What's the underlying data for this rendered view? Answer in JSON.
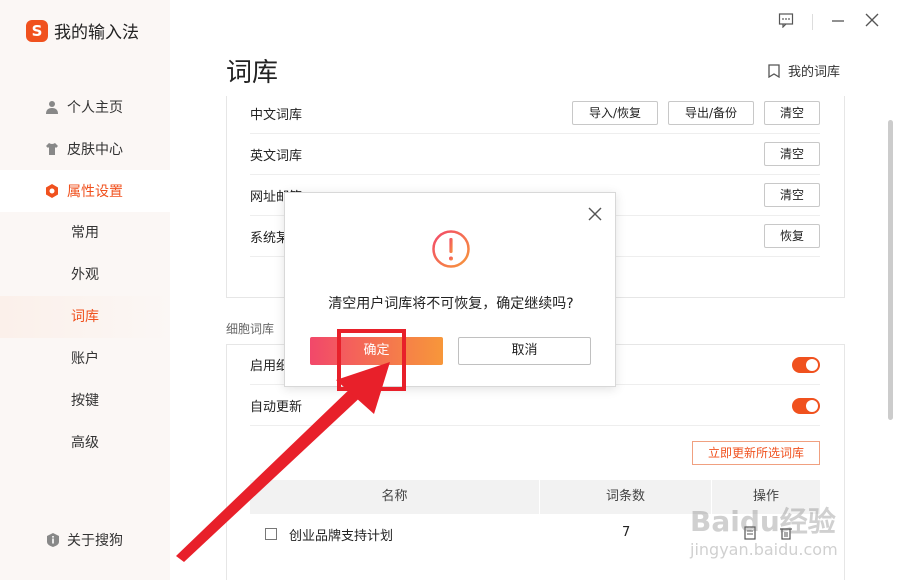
{
  "app": {
    "name": "我的输入法",
    "logo_letter": "S"
  },
  "sidebar": {
    "items": [
      {
        "label": "个人主页"
      },
      {
        "label": "皮肤中心"
      },
      {
        "label": "属性设置"
      }
    ],
    "sub_items": [
      {
        "label": "常用"
      },
      {
        "label": "外观"
      },
      {
        "label": "词库"
      },
      {
        "label": "账户"
      },
      {
        "label": "按键"
      },
      {
        "label": "高级"
      }
    ],
    "about": "关于搜狗"
  },
  "header": {
    "title": "词库",
    "my_library": "我的词库"
  },
  "library_rows": [
    {
      "label": "中文词库",
      "buttons": [
        "导入/恢复",
        "导出/备份",
        "清空"
      ]
    },
    {
      "label": "英文词库",
      "buttons": [
        "清空"
      ]
    },
    {
      "label": "网址邮箱",
      "buttons": [
        "清空"
      ]
    },
    {
      "label": "系统某",
      "buttons": [
        "恢复"
      ]
    }
  ],
  "cell_section": {
    "label": "细胞词库",
    "enable_label": "启用细",
    "auto_update_label": "自动更新",
    "update_button": "立即更新所选词库",
    "table": {
      "headers": [
        "名称",
        "词条数",
        "操作"
      ],
      "rows": [
        {
          "name": "创业品牌支持计划",
          "count": "7"
        }
      ]
    }
  },
  "modal": {
    "message": "清空用户词库将不可恢复，确定继续吗?",
    "confirm": "确定",
    "cancel": "取消"
  },
  "watermark": {
    "main": "Baidu经验",
    "sub": "jingyan.baidu.com"
  },
  "colors": {
    "accent": "#f0511e",
    "annotation": "#e8202a"
  }
}
